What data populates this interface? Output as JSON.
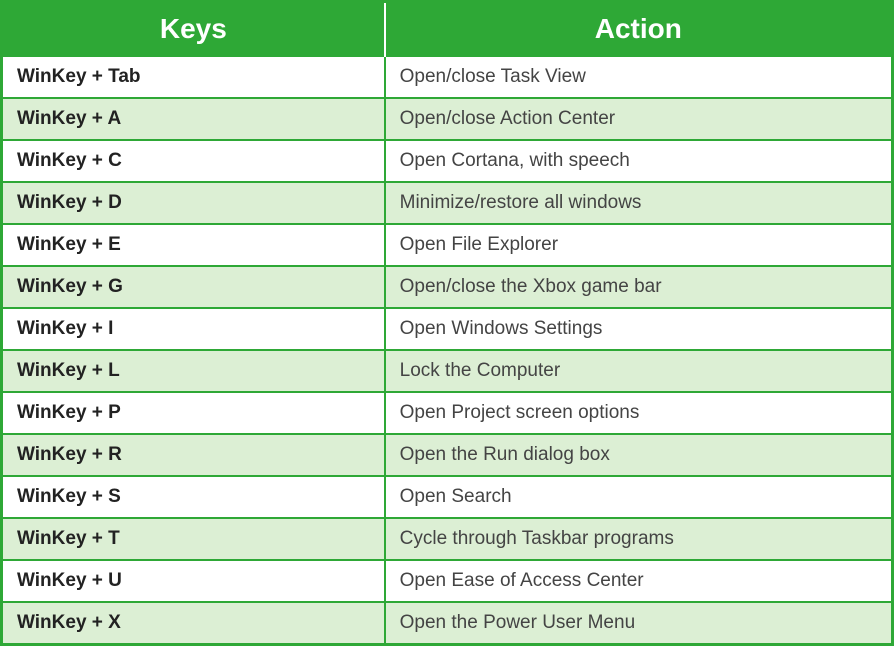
{
  "table": {
    "headers": {
      "keys": "Keys",
      "action": "Action"
    },
    "rows": [
      {
        "keys": "WinKey + Tab",
        "action": "Open/close Task View"
      },
      {
        "keys": "WinKey + A",
        "action": "Open/close Action Center"
      },
      {
        "keys": "WinKey + C",
        "action": "Open Cortana, with speech"
      },
      {
        "keys": "WinKey  + D",
        "action": "Minimize/restore all windows"
      },
      {
        "keys": "WinKey  + E",
        "action": "Open File Explorer"
      },
      {
        "keys": "WinKey  + G",
        "action": "Open/close the Xbox game bar"
      },
      {
        "keys": "WinKey + I",
        "action": "Open Windows Settings"
      },
      {
        "keys": "WinKey  + L",
        "action": "Lock the Computer"
      },
      {
        "keys": "WinKey  + P",
        "action": "Open Project screen options"
      },
      {
        "keys": "WinKey  + R",
        "action": "Open the Run dialog box"
      },
      {
        "keys": "WinKey  + S",
        "action": "Open Search"
      },
      {
        "keys": "WinKey  + T",
        "action": "Cycle through Taskbar programs"
      },
      {
        "keys": "WinKey  + U",
        "action": "Open Ease of Access Center"
      },
      {
        "keys": "WinKey  + X",
        "action": "Open the Power User Menu"
      }
    ]
  }
}
